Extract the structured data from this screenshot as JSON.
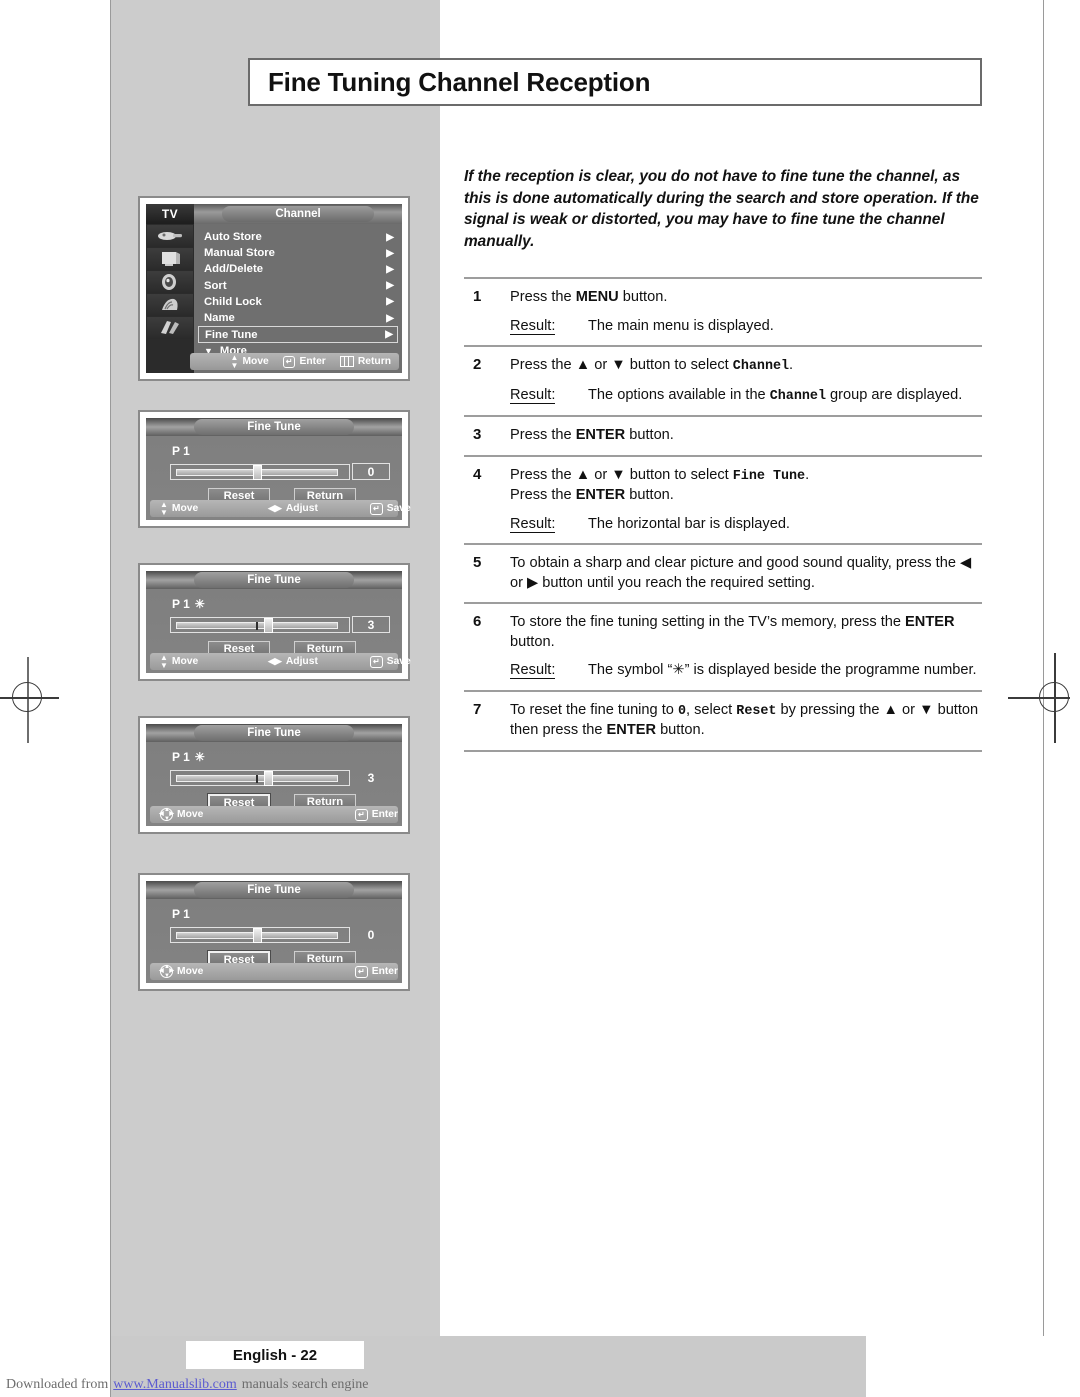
{
  "page": {
    "title": "Fine Tuning Channel Reception",
    "page_label": "English - 22",
    "footer": {
      "prefix": "Downloaded from",
      "link": "www.Manualslib.com",
      "suffix": "manuals search engine"
    }
  },
  "intro": "If the reception is clear, you do not have to fine tune the channel, as this is done automatically during the search and store operation. If the signal is weak or distorted, you may have to fine tune the channel manually.",
  "steps": [
    {
      "num": "1",
      "body_parts": [
        {
          "t": "Press the ",
          "s": "plain"
        },
        {
          "t": "MENU",
          "s": "bold"
        },
        {
          "t": " button.",
          "s": "plain"
        }
      ],
      "result_label": "Result",
      "result": "The main menu is displayed."
    },
    {
      "num": "2",
      "body_parts": [
        {
          "t": "Press the ",
          "s": "plain"
        },
        {
          "t": "▲",
          "s": "plain"
        },
        {
          "t": " or ",
          "s": "plain"
        },
        {
          "t": "▼",
          "s": "plain"
        },
        {
          "t": " button to select ",
          "s": "plain"
        },
        {
          "t": "Channel",
          "s": "mono"
        },
        {
          "t": ".",
          "s": "plain"
        }
      ],
      "result_label": "Result",
      "result": "The options available in the Channel group are displayed.",
      "result_mono_word": "Channel"
    },
    {
      "num": "3",
      "body_parts": [
        {
          "t": "Press the ",
          "s": "plain"
        },
        {
          "t": "ENTER",
          "s": "bold"
        },
        {
          "t": " button.",
          "s": "plain"
        }
      ]
    },
    {
      "num": "4",
      "body_parts": [
        {
          "t": "Press the ▲ or ▼ button to select ",
          "s": "plain"
        },
        {
          "t": "Fine Tune",
          "s": "mono"
        },
        {
          "t": ".",
          "s": "plain"
        }
      ],
      "body_line2": "Press the ENTER button.",
      "result_label": "Result",
      "result": "The horizontal bar is displayed."
    },
    {
      "num": "5",
      "body_parts": [
        {
          "t": "To obtain a sharp and clear picture and good sound quality, press the ◀ or ▶ button until you reach the required setting.",
          "s": "plain"
        }
      ]
    },
    {
      "num": "6",
      "body_parts": [
        {
          "t": "To store the fine tuning setting in the TV’s memory, press the ",
          "s": "plain"
        },
        {
          "t": "ENTER",
          "s": "bold"
        },
        {
          "t": " button.",
          "s": "plain"
        }
      ],
      "result_label": "Result",
      "result": "The symbol “✳” is displayed beside the programme number."
    },
    {
      "num": "7",
      "body_parts": [
        {
          "t": "To reset the fine tuning to ",
          "s": "plain"
        },
        {
          "t": "0",
          "s": "mono"
        },
        {
          "t": ", select ",
          "s": "plain"
        },
        {
          "t": "Reset",
          "s": "mono"
        },
        {
          "t": " by pressing the ▲ or ▼ button then press the ",
          "s": "plain"
        },
        {
          "t": "ENTER",
          "s": "bold"
        },
        {
          "t": " button.",
          "s": "plain"
        }
      ]
    }
  ],
  "osd": {
    "tv_menu": {
      "source_label": "TV",
      "group_title": "Channel",
      "items": [
        {
          "label": "Auto Store",
          "arrow": "▶",
          "selected": false
        },
        {
          "label": "Manual Store",
          "arrow": "▶",
          "selected": false
        },
        {
          "label": "Add/Delete",
          "arrow": "▶",
          "selected": false
        },
        {
          "label": "Sort",
          "arrow": "▶",
          "selected": false
        },
        {
          "label": "Child Lock",
          "arrow": "▶",
          "selected": false
        },
        {
          "label": "Name",
          "arrow": "▶",
          "selected": false
        },
        {
          "label": "Fine Tune",
          "arrow": "▶",
          "selected": true
        }
      ],
      "more_label": "More",
      "more_glyph": "▼",
      "footer": [
        {
          "icon": "up-down-arrow-icon",
          "label": "Move"
        },
        {
          "icon": "enter-icon",
          "label": "Enter"
        },
        {
          "icon": "return-icon",
          "label": "Return"
        }
      ],
      "icon_names": [
        "input-source-icon",
        "picture-icon",
        "sound-icon",
        "channel-icon",
        "setup-icon"
      ]
    },
    "fine_tune_dialogs": [
      {
        "title": "Fine Tune",
        "programme": "P 1",
        "star": "",
        "value": "0",
        "knob_pct": 50,
        "tick_pct": null,
        "buttons": [
          {
            "label": "Reset",
            "selected": false
          },
          {
            "label": "Return",
            "selected": false
          }
        ],
        "footer": [
          {
            "icon": "up-down-arrow-icon",
            "label": "Move"
          },
          {
            "icon": "left-right-arrow-icon",
            "label": "Adjust"
          },
          {
            "icon": "enter-icon",
            "label": "Save"
          }
        ]
      },
      {
        "title": "Fine Tune",
        "programme": "P 1",
        "star": "✳",
        "value": "3",
        "knob_pct": 57,
        "tick_pct": 50,
        "buttons": [
          {
            "label": "Reset",
            "selected": false
          },
          {
            "label": "Return",
            "selected": false
          }
        ],
        "footer": [
          {
            "icon": "up-down-arrow-icon",
            "label": "Move"
          },
          {
            "icon": "left-right-arrow-icon",
            "label": "Adjust"
          },
          {
            "icon": "enter-icon",
            "label": "Save"
          }
        ]
      },
      {
        "title": "Fine Tune",
        "programme": "P 1",
        "star": "✳",
        "value": "3",
        "knob_pct": 57,
        "tick_pct": 50,
        "buttons": [
          {
            "label": "Reset",
            "selected": true
          },
          {
            "label": "Return",
            "selected": false
          }
        ],
        "footer": [
          {
            "icon": "dpad-icon",
            "label": "Move"
          },
          {
            "icon": "enter-icon",
            "label": "Enter"
          }
        ]
      },
      {
        "title": "Fine Tune",
        "programme": "P 1",
        "star": "",
        "value": "0",
        "knob_pct": 50,
        "tick_pct": null,
        "buttons": [
          {
            "label": "Reset",
            "selected": true
          },
          {
            "label": "Return",
            "selected": false
          }
        ],
        "footer": [
          {
            "icon": "dpad-icon",
            "label": "Move"
          },
          {
            "icon": "enter-icon",
            "label": "Enter"
          }
        ]
      }
    ]
  },
  "colors": {
    "band": "#cccccc",
    "rule": "#9d9d9d",
    "osd_grey": "#808080",
    "link": "#5b5bd0"
  }
}
